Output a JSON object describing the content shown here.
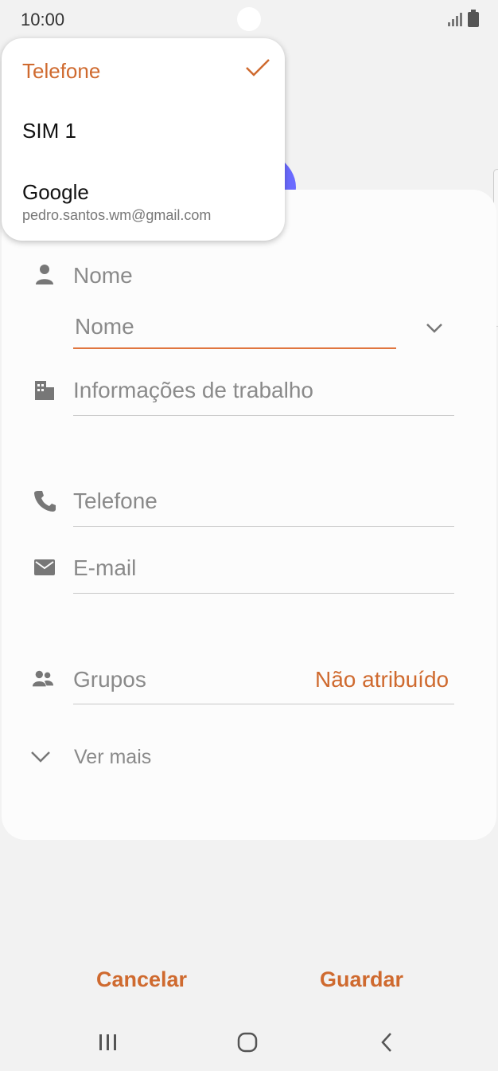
{
  "status": {
    "time": "10:00"
  },
  "dropdown": {
    "items": [
      {
        "label": "Telefone",
        "selected": true
      },
      {
        "label": "SIM 1"
      },
      {
        "label": "Google",
        "sublabel": "pedro.santos.wm@gmail.com"
      }
    ]
  },
  "form": {
    "name_section_label": "Nome",
    "name_input_placeholder": "Nome",
    "work_label": "Informações de trabalho",
    "phone_label": "Telefone",
    "email_label": "E-mail",
    "groups_label": "Grupos",
    "groups_value": "Não atribuído",
    "see_more_label": "Ver mais"
  },
  "actions": {
    "cancel": "Cancelar",
    "save": "Guardar"
  },
  "colors": {
    "accent": "#cf6a2f",
    "avatar": "#6b6bff",
    "icon_gray": "#777777"
  },
  "icons": [
    "signal-icon",
    "battery-icon",
    "person-icon",
    "building-icon",
    "phone-icon",
    "mail-icon",
    "group-icon",
    "chevron-down-icon",
    "check-icon",
    "recent-apps-icon",
    "home-icon",
    "back-icon"
  ]
}
